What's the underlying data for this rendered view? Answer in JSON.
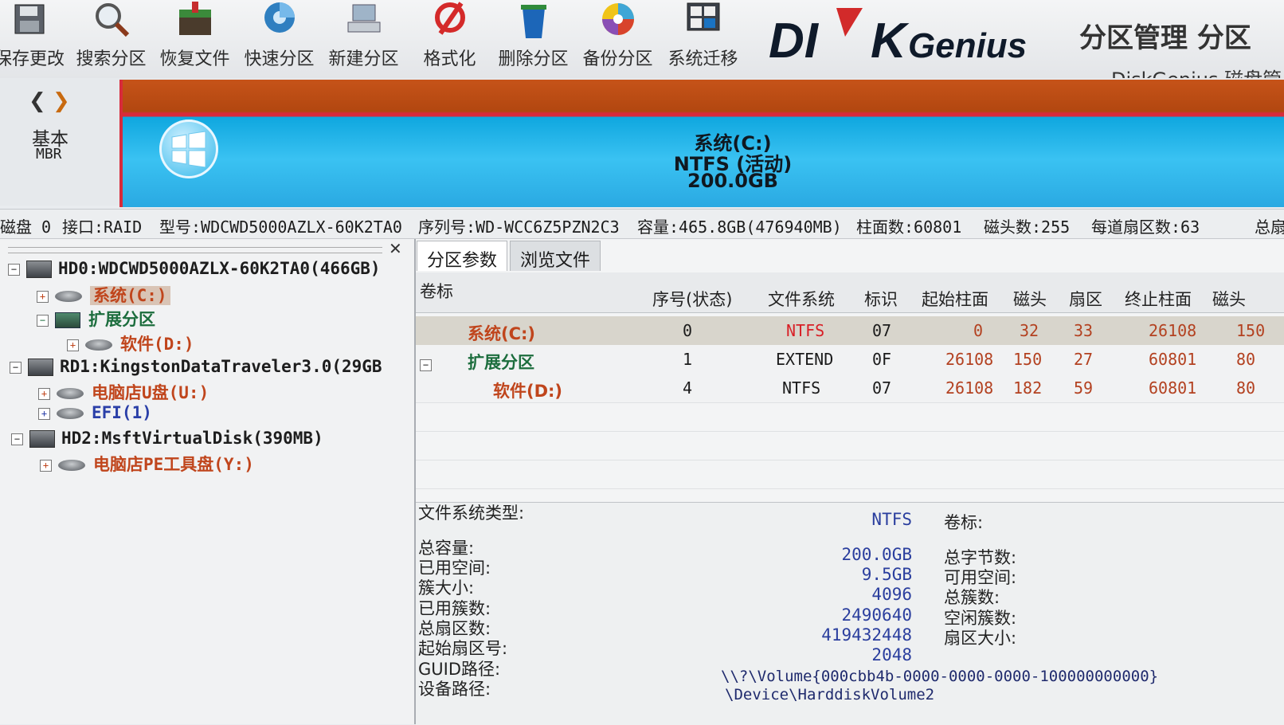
{
  "toolbar": {
    "buttons": [
      {
        "label": "保存更改",
        "icon": "save-icon"
      },
      {
        "label": "搜索分区",
        "icon": "search-icon"
      },
      {
        "label": "恢复文件",
        "icon": "restore-files-icon"
      },
      {
        "label": "快速分区",
        "icon": "quick-partition-icon"
      },
      {
        "label": "新建分区",
        "icon": "new-partition-icon"
      },
      {
        "label": "格式化",
        "icon": "format-icon"
      },
      {
        "label": "删除分区",
        "icon": "delete-partition-icon"
      },
      {
        "label": "备份分区",
        "icon": "backup-partition-icon"
      },
      {
        "label": "系统迁移",
        "icon": "system-migration-icon"
      }
    ],
    "brand_logo": "DISKGenius",
    "brand_title": "分区管理 分区",
    "brand_subtitle": "DiskGenius 磁盘管"
  },
  "diskmap": {
    "disk_kind": "基本",
    "disk_style": "MBR",
    "partition_name": "系统(C:)",
    "partition_fs": "NTFS (活动)",
    "partition_size": "200.0GB",
    "colors": {
      "bar_top": "#c65319",
      "bar_main": "#2fb6ec",
      "bar_border": "#d72b3a"
    }
  },
  "diskinfo": {
    "disk": "磁盘 0",
    "interface": "接口:RAID",
    "model": "型号:WDCWD5000AZLX-60K2TA0",
    "serial": "序列号:WD-WCC6Z5PZN2C3",
    "capacity": "容量:465.8GB(476940MB)",
    "cylinders": "柱面数:60801",
    "heads": "磁头数:255",
    "sectors_per_track": "每道扇区数:63",
    "total": "总扇"
  },
  "tree": {
    "hd0": "HD0:WDCWD5000AZLX-60K2TA0(466GB)",
    "hd0_c": "系统(C:)",
    "hd0_ext": "扩展分区",
    "hd0_d": "软件(D:)",
    "rd1": "RD1:KingstonDataTraveler3.0(29GB",
    "rd1_u": "电脑店U盘(U:)",
    "rd1_efi": "EFI(1)",
    "hd2": "HD2:MsftVirtualDisk(390MB)",
    "hd2_y": "电脑店PE工具盘(Y:)"
  },
  "tabs": {
    "params": "分区参数",
    "browse": "浏览文件"
  },
  "grid": {
    "headers": [
      "卷标",
      "序号(状态)",
      "文件系统",
      "标识",
      "起始柱面",
      "磁头",
      "扇区",
      "终止柱面",
      "磁头"
    ],
    "rows": [
      {
        "name": "系统(C:)",
        "seq": "0",
        "fs": "NTFS",
        "id": "07",
        "start_cyl": "0",
        "head": "32",
        "sector": "33",
        "end_cyl": "26108",
        "end_head": "150"
      },
      {
        "name": "扩展分区",
        "seq": "1",
        "fs": "EXTEND",
        "id": "0F",
        "start_cyl": "26108",
        "head": "150",
        "sector": "27",
        "end_cyl": "60801",
        "end_head": "80"
      },
      {
        "name": "软件(D:)",
        "seq": "4",
        "fs": "NTFS",
        "id": "07",
        "start_cyl": "26108",
        "head": "182",
        "sector": "59",
        "end_cyl": "60801",
        "end_head": "80"
      }
    ]
  },
  "details": {
    "fs_type_label": "文件系统类型:",
    "fs_type_value": "NTFS",
    "volume_label_label": "卷标:",
    "total_capacity_label": "总容量:",
    "total_capacity_value": "200.0GB",
    "total_bytes_label": "总字节数:",
    "used_space_label": "已用空间:",
    "used_space_value": "9.5GB",
    "free_space_label": "可用空间:",
    "cluster_size_label": "簇大小:",
    "cluster_size_value": "4096",
    "total_clusters_label": "总簇数:",
    "used_clusters_label": "已用簇数:",
    "used_clusters_value": "2490640",
    "free_clusters_label": "空闲簇数:",
    "total_sectors_label": "总扇区数:",
    "total_sectors_value": "419432448",
    "sector_size_label": "扇区大小:",
    "start_sector_label": "起始扇区号:",
    "start_sector_value": "2048",
    "guid_path_label": "GUID路径:",
    "guid_path_value": "\\\\?\\Volume{000cbb4b-0000-0000-0000-100000000000}",
    "device_path_label": "设备路径:",
    "device_path_value": "\\Device\\HarddiskVolume2"
  }
}
